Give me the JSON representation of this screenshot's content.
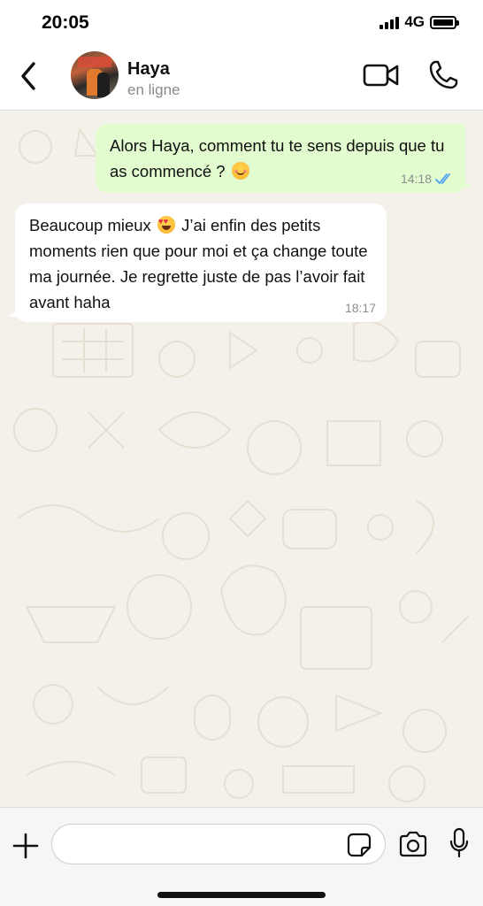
{
  "status_bar": {
    "time": "20:05",
    "network": "4G"
  },
  "header": {
    "contact_name": "Haya",
    "contact_status": "en ligne",
    "icons": [
      "back-chevron-icon",
      "avatar",
      "video-camera-icon",
      "phone-icon"
    ]
  },
  "messages": [
    {
      "direction": "outgoing",
      "text_before": "Alors Haya, comment tu te sens depuis que tu as commencé ?",
      "emoji": "smiling-face-emoji",
      "time": "14:18",
      "read_ticks_color": "#4a9ff5"
    },
    {
      "direction": "incoming",
      "text_before": "Beaucoup mieux",
      "emoji": "heart-eyes-emoji",
      "text_after": "J’ai enfin des petits moments rien que pour moi et ça change toute ma journée. Je regrette juste de pas l’avoir fait avant haha",
      "time": "18:17"
    }
  ],
  "composer": {
    "input_value": "",
    "icons": [
      "plus-icon",
      "sticker-icon",
      "camera-icon",
      "microphone-icon"
    ]
  },
  "colors": {
    "outgoing_bubble": "#e2fbcf",
    "incoming_bubble": "#ffffff",
    "chat_background": "#f4f1ea",
    "read_ticks": "#4a9ff5"
  }
}
